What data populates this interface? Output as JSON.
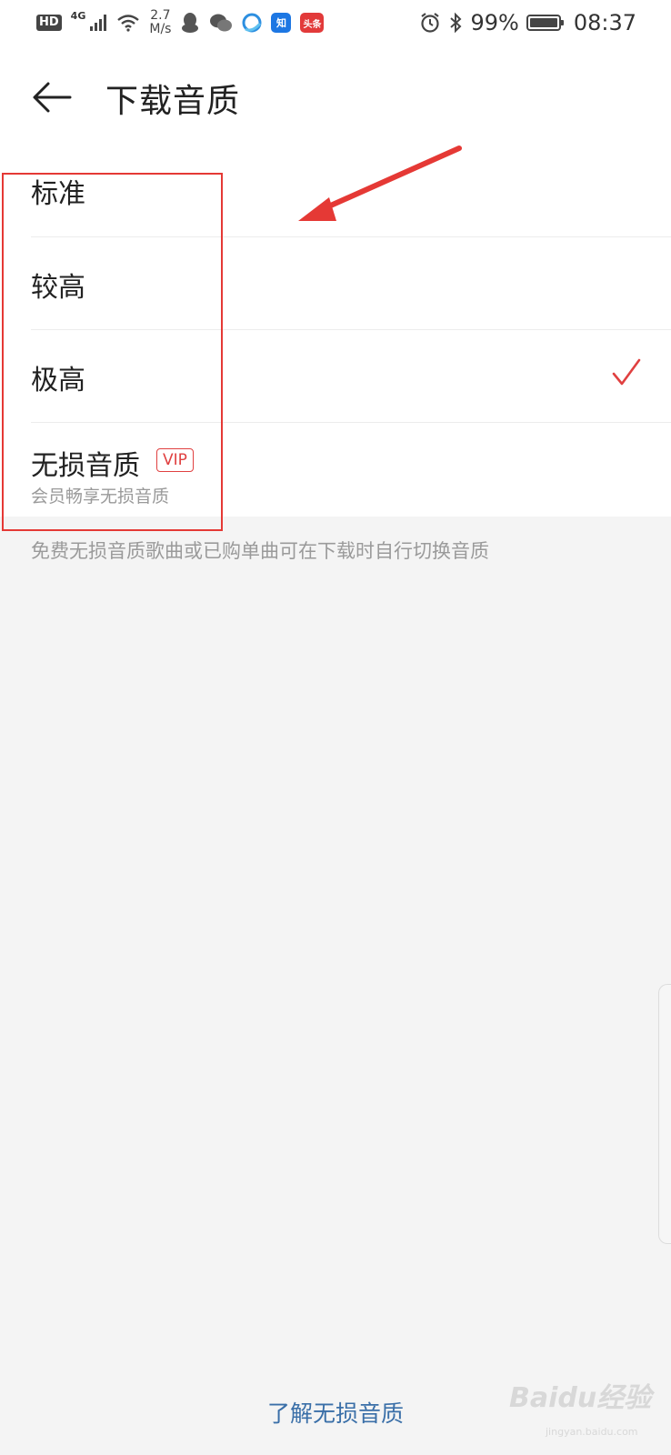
{
  "status_bar": {
    "hd": "HD",
    "network": "4G",
    "speed_value": "2.7",
    "speed_unit": "M/s",
    "app_zhihu": "知",
    "app_toutiao": "头条",
    "battery": "99%",
    "time": "08:37"
  },
  "header": {
    "title": "下载音质"
  },
  "options": [
    {
      "label": "标准",
      "selected": false
    },
    {
      "label": "较高",
      "selected": false
    },
    {
      "label": "极高",
      "selected": true
    },
    {
      "label": "无损音质",
      "badge": "VIP",
      "sub": "会员畅享无损音质",
      "selected": false
    }
  ],
  "note": "免费无损音质歌曲或已购单曲可在下载时自行切换音质",
  "learn_link": "了解无损音质",
  "watermark": {
    "main": "Baidu经验",
    "sub": "jingyan.baidu.com"
  },
  "colors": {
    "accent_red": "#e04040",
    "link_blue": "#3a6fa8",
    "annotation_red": "#e53935"
  }
}
